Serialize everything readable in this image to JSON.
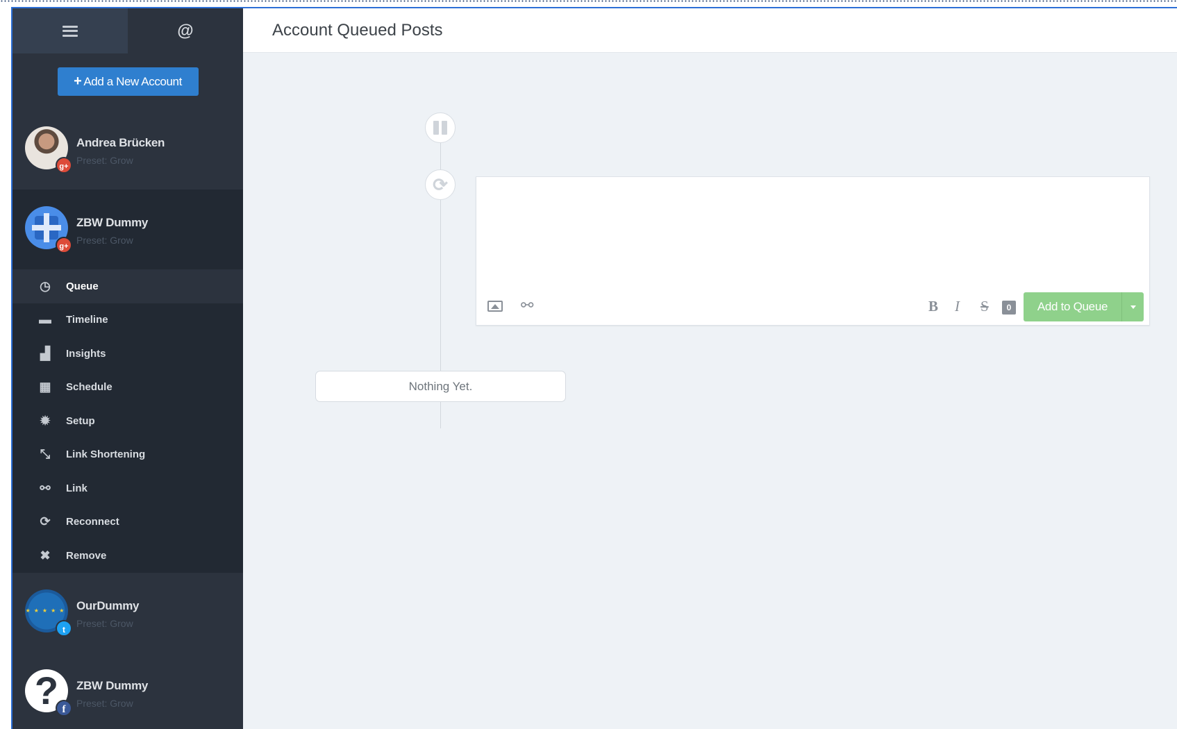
{
  "sidebar": {
    "top_tabs": {
      "menu_icon": "hamburger-icon",
      "mentions_label": "@"
    },
    "add_account_label": "Add a New Account",
    "accounts": [
      {
        "name": "Andrea Brücken",
        "preset": "Preset: Grow",
        "network": "google-plus"
      },
      {
        "name": "ZBW Dummy",
        "preset": "Preset: Grow",
        "network": "google-plus"
      },
      {
        "name": "OurDummy",
        "preset": "Preset: Grow",
        "network": "twitter"
      },
      {
        "name": "ZBW Dummy",
        "preset": "Preset: Grow",
        "network": "facebook"
      }
    ],
    "menu": [
      {
        "label": "Queue",
        "icon": "clock-icon"
      },
      {
        "label": "Timeline",
        "icon": "archive-icon"
      },
      {
        "label": "Insights",
        "icon": "bar-chart-icon"
      },
      {
        "label": "Schedule",
        "icon": "calendar-icon"
      },
      {
        "label": "Setup",
        "icon": "gear-icon"
      },
      {
        "label": "Link Shortening",
        "icon": "compress-icon"
      },
      {
        "label": "Link",
        "icon": "link-icon"
      },
      {
        "label": "Reconnect",
        "icon": "refresh-icon"
      },
      {
        "label": "Remove",
        "icon": "close-icon"
      }
    ],
    "badges": {
      "google_plus": "g+",
      "twitter": "t",
      "facebook": "f"
    }
  },
  "main": {
    "title": "Account Queued Posts",
    "composer": {
      "placeholder": "",
      "char_count": "0",
      "bold": "B",
      "italic": "I",
      "strike": "S",
      "submit_label": "Add to Queue"
    },
    "empty_state": "Nothing Yet."
  },
  "colors": {
    "sidebar_bg": "#2c333e",
    "sidebar_active_bg": "#222933",
    "accent_blue": "#2f7fcf",
    "queue_green": "#8fd18b",
    "main_bg": "#eef2f6"
  }
}
